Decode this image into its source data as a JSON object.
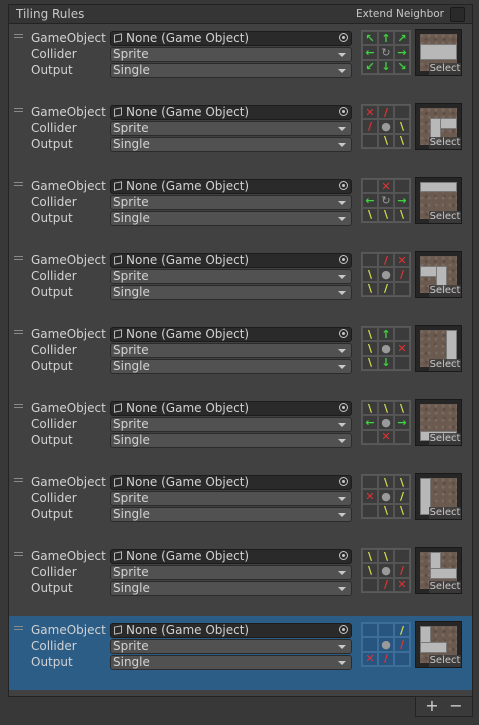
{
  "header": {
    "title": "Tiling Rules",
    "extend_label": "Extend Neighbor"
  },
  "labels": {
    "gameobject": "GameObject",
    "collider": "Collider",
    "output": "Output",
    "select": "Select"
  },
  "rules": [
    {
      "gameobject": "None (Game Object)",
      "collider": "Sprite",
      "output": "Single",
      "cells": [
        [
          "green",
          "↖"
        ],
        [
          "green",
          "↑"
        ],
        [
          "green",
          "↗"
        ],
        [
          "green",
          "←"
        ],
        [
          "gray",
          "↻"
        ],
        [
          "green",
          "→"
        ],
        [
          "green",
          "↙"
        ],
        [
          "green",
          "↓"
        ],
        [
          "green",
          "↘"
        ]
      ]
    },
    {
      "gameobject": "None (Game Object)",
      "collider": "Sprite",
      "output": "Single",
      "cells": [
        [
          "red",
          "✕"
        ],
        [
          "red",
          "/"
        ],
        [
          "",
          ""
        ],
        [
          "red",
          "/"
        ],
        [
          "gray",
          "●"
        ],
        [
          "yellow",
          "\\"
        ],
        [
          "",
          ""
        ],
        [
          "yellow",
          "\\"
        ],
        [
          "yellow",
          "\\"
        ]
      ]
    },
    {
      "gameobject": "None (Game Object)",
      "collider": "Sprite",
      "output": "Single",
      "cells": [
        [
          "",
          ""
        ],
        [
          "red",
          "✕"
        ],
        [
          "",
          ""
        ],
        [
          "green",
          "←"
        ],
        [
          "gray",
          "↻"
        ],
        [
          "green",
          "→"
        ],
        [
          "yellow",
          "\\"
        ],
        [
          "yellow",
          "\\"
        ],
        [
          "yellow",
          "\\"
        ]
      ]
    },
    {
      "gameobject": "None (Game Object)",
      "collider": "Sprite",
      "output": "Single",
      "cells": [
        [
          "",
          ""
        ],
        [
          "red",
          "/"
        ],
        [
          "red",
          "✕"
        ],
        [
          "yellow",
          "\\"
        ],
        [
          "gray",
          "●"
        ],
        [
          "red",
          "/"
        ],
        [
          "yellow",
          "\\"
        ],
        [
          "yellow",
          "/"
        ],
        [
          "",
          ""
        ]
      ]
    },
    {
      "gameobject": "None (Game Object)",
      "collider": "Sprite",
      "output": "Single",
      "cells": [
        [
          "yellow",
          "\\"
        ],
        [
          "green",
          "↑"
        ],
        [
          "",
          ""
        ],
        [
          "yellow",
          "\\"
        ],
        [
          "gray",
          "●"
        ],
        [
          "red",
          "✕"
        ],
        [
          "yellow",
          "\\"
        ],
        [
          "green",
          "↓"
        ],
        [
          "",
          ""
        ]
      ]
    },
    {
      "gameobject": "None (Game Object)",
      "collider": "Sprite",
      "output": "Single",
      "cells": [
        [
          "yellow",
          "\\"
        ],
        [
          "yellow",
          "\\"
        ],
        [
          "yellow",
          "\\"
        ],
        [
          "green",
          "←"
        ],
        [
          "gray",
          "●"
        ],
        [
          "green",
          "→"
        ],
        [
          "",
          ""
        ],
        [
          "red",
          "✕"
        ],
        [
          "",
          ""
        ]
      ]
    },
    {
      "gameobject": "None (Game Object)",
      "collider": "Sprite",
      "output": "Single",
      "cells": [
        [
          "",
          ""
        ],
        [
          "yellow",
          "\\"
        ],
        [
          "yellow",
          "\\"
        ],
        [
          "red",
          "✕"
        ],
        [
          "gray",
          "●"
        ],
        [
          "yellow",
          "/"
        ],
        [
          "",
          ""
        ],
        [
          "yellow",
          "\\"
        ],
        [
          "yellow",
          "\\"
        ]
      ]
    },
    {
      "gameobject": "None (Game Object)",
      "collider": "Sprite",
      "output": "Single",
      "cells": [
        [
          "yellow",
          "\\"
        ],
        [
          "yellow",
          "\\"
        ],
        [
          "",
          ""
        ],
        [
          "yellow",
          "\\"
        ],
        [
          "gray",
          "●"
        ],
        [
          "red",
          "/"
        ],
        [
          "",
          ""
        ],
        [
          "red",
          "/"
        ],
        [
          "red",
          "✕"
        ]
      ]
    },
    {
      "gameobject": "None (Game Object)",
      "collider": "Sprite",
      "output": "Single",
      "cells": [
        [
          "",
          ""
        ],
        [
          "",
          ""
        ],
        [
          "yellow",
          "/"
        ],
        [
          "",
          ""
        ],
        [
          "gray",
          "●"
        ],
        [
          "red",
          "/"
        ],
        [
          "red",
          "✕"
        ],
        [
          "red",
          "/"
        ],
        [
          "",
          ""
        ]
      ]
    }
  ],
  "footer": {
    "add": "+",
    "remove": "−"
  }
}
